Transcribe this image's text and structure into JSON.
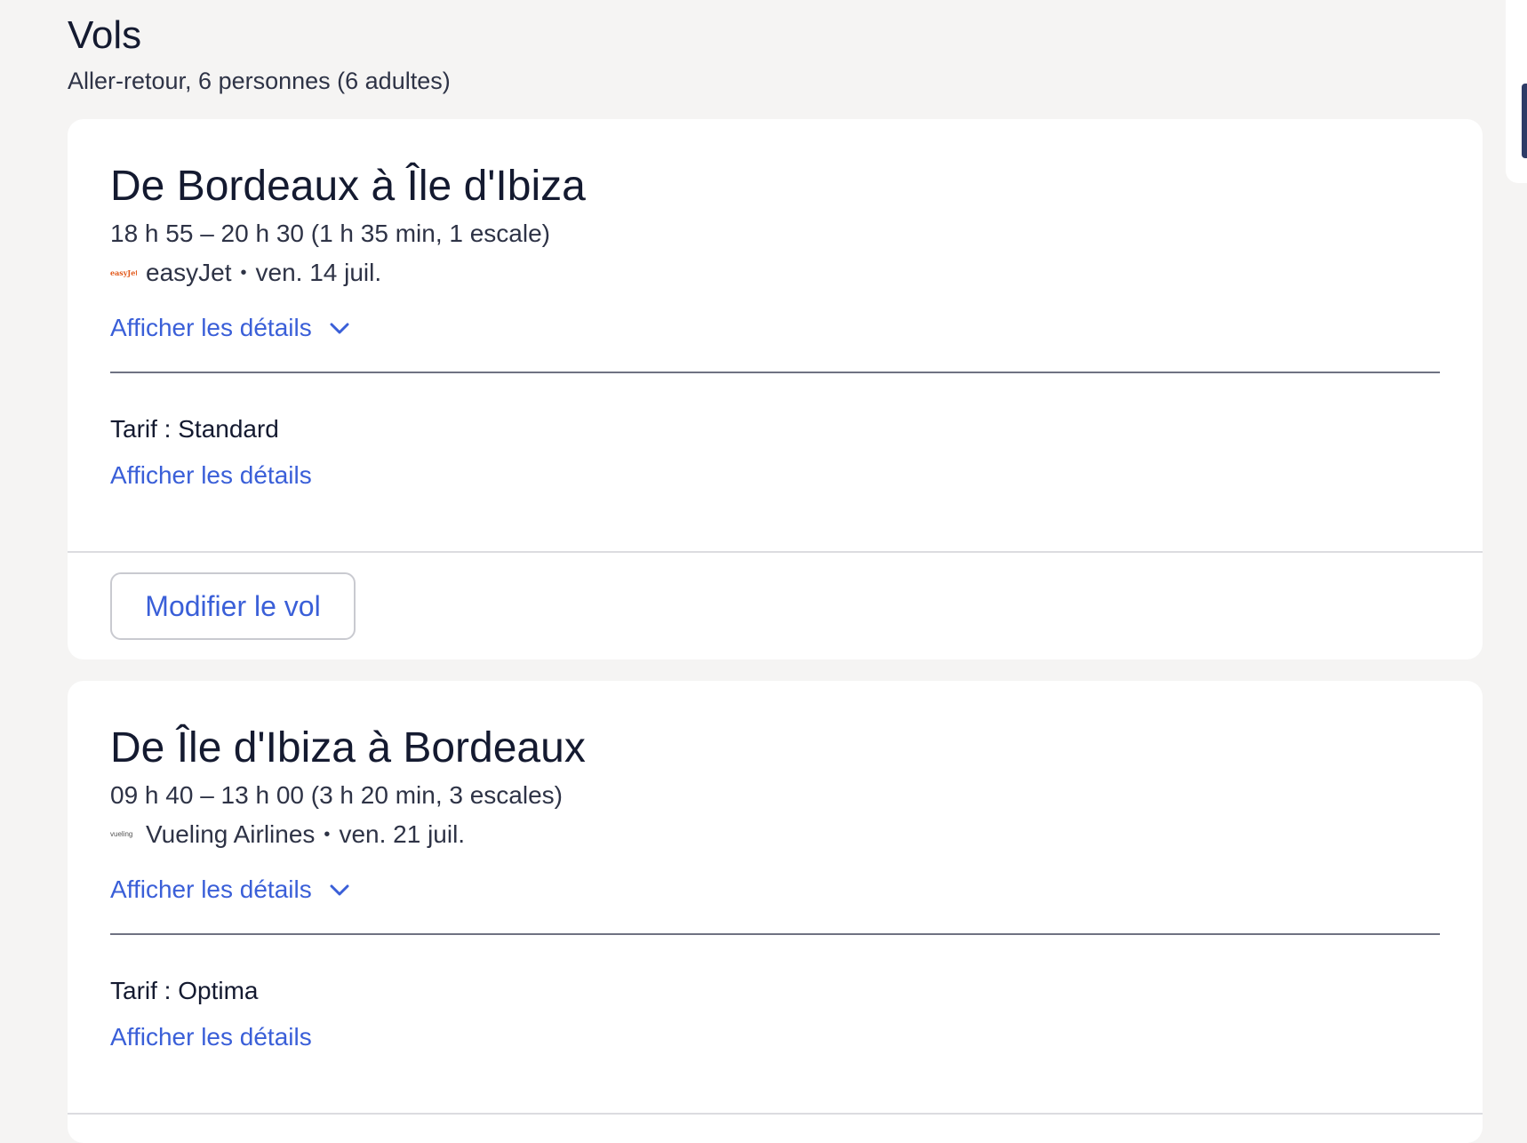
{
  "header": {
    "title": "Vols",
    "subtitle": "Aller-retour, 6 personnes (6 adultes)"
  },
  "flights": [
    {
      "title": "De Bordeaux à Île d'Ibiza",
      "times": "18 h 55 – 20 h 30 (1 h 35 min, 1 escale)",
      "airline_logo_text": "easyJet",
      "airline": "easyJet",
      "separator": "•",
      "date": "ven. 14 juil.",
      "details_label": "Afficher les détails",
      "fare_label": "Tarif : Standard",
      "fare_details_label": "Afficher les détails",
      "modify_label": "Modifier le vol",
      "logo_color": "#e25a1c"
    },
    {
      "title": "De Île d'Ibiza à Bordeaux",
      "times": "09 h 40 – 13 h 00 (3 h 20 min, 3 escales)",
      "airline_logo_text": "vueling",
      "airline": "Vueling Airlines",
      "separator": "•",
      "date": "ven. 21 juil.",
      "details_label": "Afficher les détails",
      "fare_label": "Tarif : Optima",
      "fare_details_label": "Afficher les détails"
    }
  ],
  "colors": {
    "background": "#f5f4f3",
    "link": "#3a5fd8",
    "text_primary": "#141a30",
    "card": "#ffffff"
  },
  "icons": {
    "details_toggle": "chevron-down-icon"
  }
}
